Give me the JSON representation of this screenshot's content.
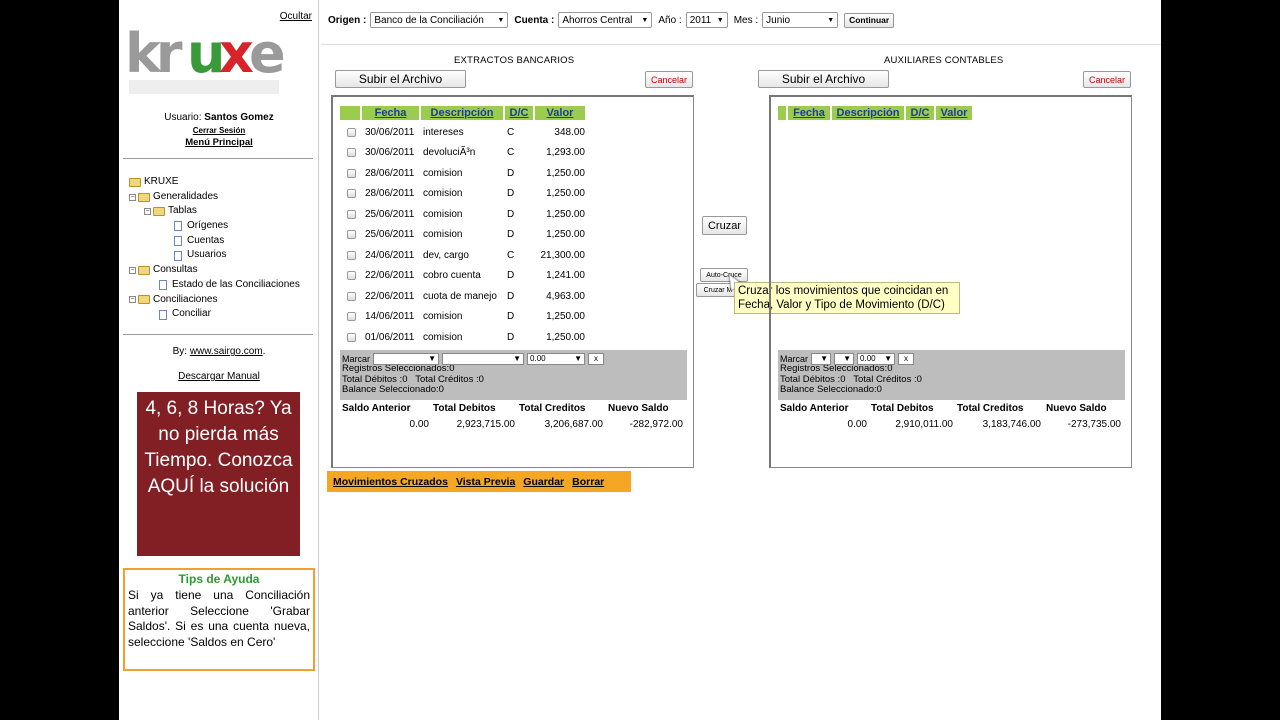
{
  "sidebar": {
    "hide_label": "Ocultar",
    "logo_text": "Kruxe",
    "user_label": "Usuario:",
    "user_name": "Santos Gomez",
    "logout": "Cerrar Sesión",
    "main_menu": "Menú Principal",
    "tree": {
      "root": "KRUXE",
      "generalidades": "Generalidades",
      "tablas": "Tablas",
      "origenes": "Orígenes",
      "cuentas": "Cuentas",
      "usuarios": "Usuarios",
      "consultas": "Consultas",
      "estado": "Estado de las Conciliaciones",
      "conciliaciones": "Conciliaciones",
      "conciliar": "Conciliar"
    },
    "by_label": "By:",
    "by_link": "www.sairgo.com",
    "by_dot": ".",
    "manual": "Descargar Manual",
    "promo": "4, 6, 8 Horas? Ya no pierda más Tiempo. Conozca AQUÍ la solución",
    "tips_title": "Tips de Ayuda",
    "tips_text": "Si ya tiene una Conciliación anterior Seleccione 'Grabar Saldos'. Si es una cuenta nueva, seleccione 'Saldos en Cero'"
  },
  "filters": {
    "origen_label": "Origen :",
    "origen_value": "Banco de la Conciliación",
    "cuenta_label": "Cuenta :",
    "cuenta_value": "Ahorros Central",
    "anio_label": "Año :",
    "anio_value": "2011",
    "mes_label": "Mes :",
    "mes_value": "Junio",
    "continue": "Continuar"
  },
  "left": {
    "title": "EXTRACTOS BANCARIOS",
    "upload": "Subir el Archivo",
    "cancel": "Cancelar",
    "columns": [
      "Fecha",
      "Descripción",
      "D/C",
      "Valor"
    ],
    "rows": [
      {
        "date": "30/06/2011",
        "desc": "intereses",
        "dc": "C",
        "val": "348.00"
      },
      {
        "date": "30/06/2011",
        "desc": "devoluciÃ³n",
        "dc": "C",
        "val": "1,293.00"
      },
      {
        "date": "28/06/2011",
        "desc": "comision",
        "dc": "D",
        "val": "1,250.00"
      },
      {
        "date": "28/06/2011",
        "desc": "comision",
        "dc": "D",
        "val": "1,250.00"
      },
      {
        "date": "25/06/2011",
        "desc": "comision",
        "dc": "D",
        "val": "1,250.00"
      },
      {
        "date": "25/06/2011",
        "desc": "comision",
        "dc": "D",
        "val": "1,250.00"
      },
      {
        "date": "24/06/2011",
        "desc": "dev, cargo",
        "dc": "C",
        "val": "21,300.00"
      },
      {
        "date": "22/06/2011",
        "desc": "cobro cuenta",
        "dc": "D",
        "val": "1,241.00"
      },
      {
        "date": "22/06/2011",
        "desc": "cuota de manejo",
        "dc": "D",
        "val": "4,963.00"
      },
      {
        "date": "14/06/2011",
        "desc": "comision",
        "dc": "D",
        "val": "1,250.00"
      },
      {
        "date": "01/06/2011",
        "desc": "comision",
        "dc": "D",
        "val": "1,250.00"
      }
    ],
    "marcar": "Marcar",
    "amount": "0.00",
    "x": "x",
    "reg_sel": "Registros Seleccionados:0",
    "tot_deb": "Total Débitos :0",
    "tot_cred": "Total Créditos :0",
    "balance": "Balance Seleccionado:0",
    "sum_headers": [
      "Saldo Anterior",
      "Total Debitos",
      "Total Creditos",
      "Nuevo Saldo"
    ],
    "sum_values": [
      "0.00",
      "2,923,715.00",
      "3,206,687.00",
      "-282,972.00"
    ]
  },
  "right": {
    "title": "AUXILIARES CONTABLES",
    "upload": "Subir el Archivo",
    "cancel": "Cancelar",
    "columns": [
      "Fecha",
      "Descripción",
      "D/C",
      "Valor"
    ],
    "marcar": "Marcar",
    "amount": "0.00",
    "x": "x",
    "reg_sel": "Registros Seleccionados:0",
    "tot_deb": "Total Débitos :0",
    "tot_cred": "Total Créditos :0",
    "balance": "Balance Seleccionado:0",
    "sum_headers": [
      "Saldo Anterior",
      "Total Debitos",
      "Total Creditos",
      "Nuevo Saldo"
    ],
    "sum_values": [
      "0.00",
      "2,910,011.00",
      "3,183,746.00",
      "-273,735.00"
    ]
  },
  "middle": {
    "cruzar": "Cruzar",
    "auto_cruce": "Auto-Cruce",
    "cruzar_small": "Cruzar M",
    "tooltip": "Cruzar los movimientos que coincidan en Fecha, Valor y Tipo de Movimiento (D/C)"
  },
  "bottom_actions": [
    "Movimientos Cruzados",
    "Vista Previa",
    "Guardar",
    "Borrar"
  ]
}
